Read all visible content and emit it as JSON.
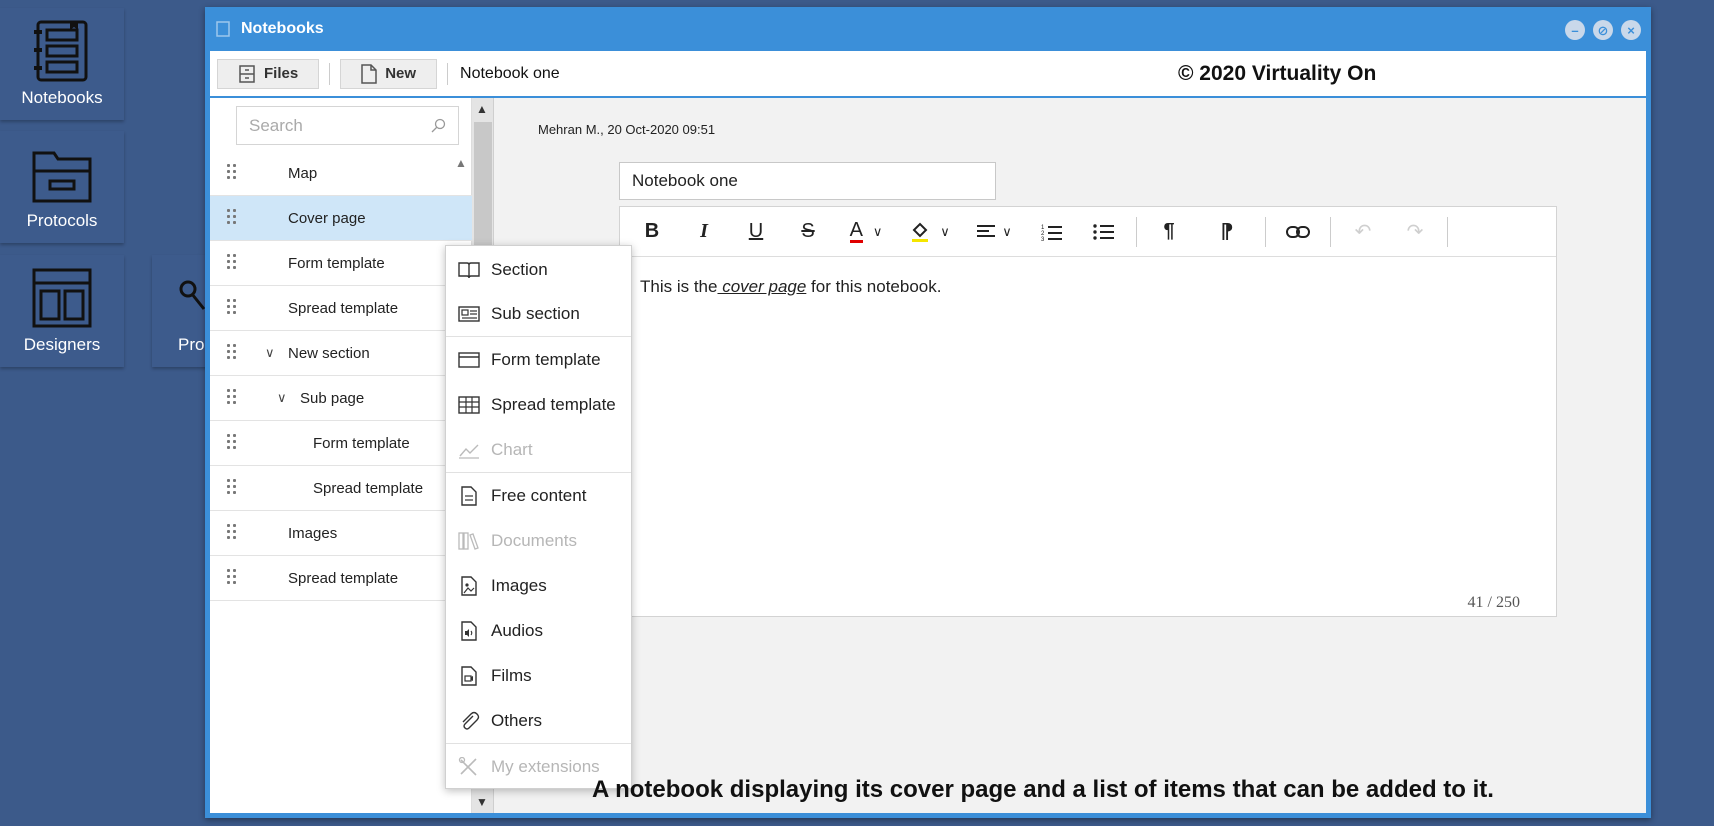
{
  "desktop": {
    "icons": [
      {
        "label": "Notebooks"
      },
      {
        "label": "Protocols"
      },
      {
        "label": "Designers"
      },
      {
        "label": "Pro"
      }
    ]
  },
  "window": {
    "title": "Notebooks",
    "controls": {
      "minimize": "–",
      "restore": "⊘",
      "close": "×"
    }
  },
  "toolbar": {
    "files_label": "Files",
    "new_label": "New",
    "notebook_name": "Notebook one",
    "copyright": "© 2020 Virtuality On"
  },
  "search": {
    "placeholder": "Search"
  },
  "tree": {
    "items": [
      {
        "label": "Map"
      },
      {
        "label": "Cover page"
      },
      {
        "label": "Form template"
      },
      {
        "label": "Spread template"
      },
      {
        "label": "New section"
      },
      {
        "label": "Sub page"
      },
      {
        "label": "Form template"
      },
      {
        "label": "Spread template"
      },
      {
        "label": "Images"
      },
      {
        "label": "Spread template"
      }
    ]
  },
  "editor": {
    "meta": "Mehran M., 20 Oct-2020 09:51",
    "title_value": "Notebook one",
    "content_prefix": "This is the",
    "content_emphasis": " cover page",
    "content_suffix": " for this notebook.",
    "counter": "41 / 250"
  },
  "context_menu": {
    "items": [
      {
        "label": "Section"
      },
      {
        "label": "Sub section"
      },
      {
        "label": "Form template"
      },
      {
        "label": "Spread template"
      },
      {
        "label": "Chart"
      },
      {
        "label": "Free content"
      },
      {
        "label": "Documents"
      },
      {
        "label": "Images"
      },
      {
        "label": "Audios"
      },
      {
        "label": "Films"
      },
      {
        "label": "Others"
      },
      {
        "label": "My extensions"
      }
    ]
  },
  "caption": "A notebook displaying its cover page and a list of items that can be added to it.",
  "colors": {
    "desktop": "#3c5a8a",
    "titlebar": "#3b8fd9",
    "selected_row": "#cfe6f8",
    "disabled_text": "#b6b6b6"
  }
}
